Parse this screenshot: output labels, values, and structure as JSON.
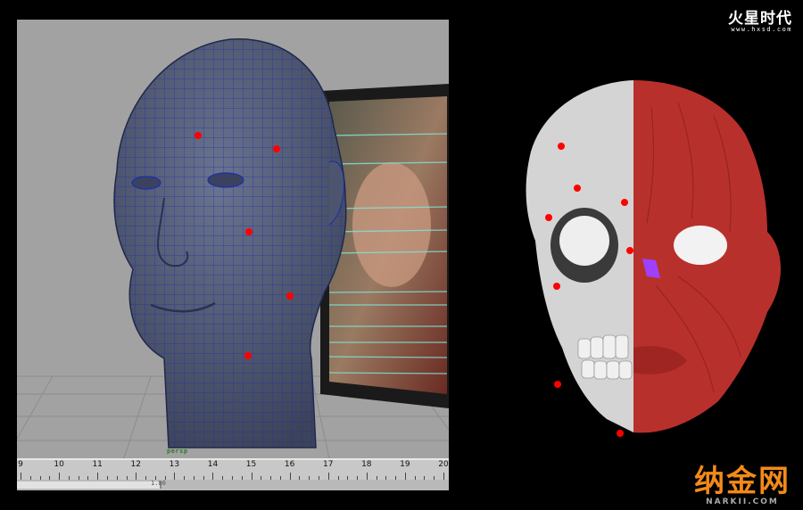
{
  "viewport": {
    "camera_label": "persp"
  },
  "timeline": {
    "ticks": [
      "9",
      "10",
      "11",
      "12",
      "13",
      "14",
      "15",
      "16",
      "17",
      "18",
      "19",
      "20"
    ],
    "range_value": "1.00"
  },
  "brand_top": {
    "name": "火星时代",
    "url": "www.hxsd.com"
  },
  "brand_bottom": {
    "name": "纳金网",
    "url": "NARKII.COM"
  },
  "colors": {
    "viewport_bg": "#a2a2a2",
    "mesh_face": "#55607a",
    "wireframe": "#1b2fa8",
    "marker": "#ff0000",
    "muscle": "#b8302c",
    "bone": "#d8d8d8",
    "brand_orange": "#f28a1a"
  }
}
